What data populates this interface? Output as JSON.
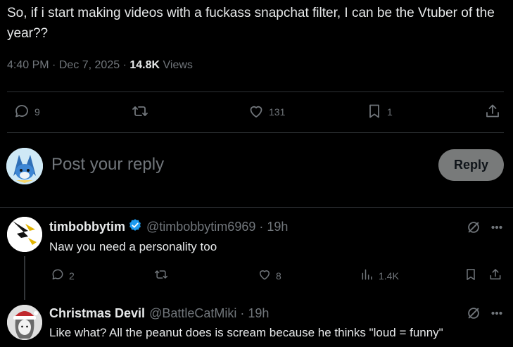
{
  "post": {
    "text": "So, if i start making videos with a fuckass snapchat filter, I can be the Vtuber of the year??",
    "time": "4:40 PM",
    "sep1": "·",
    "date": "Dec 7, 2025",
    "sep2": "·",
    "views_count": "14.8K",
    "views_label": "Views",
    "replies": "9",
    "likes": "131",
    "bookmarks": "1"
  },
  "compose": {
    "placeholder": "Post your reply",
    "button_label": "Reply"
  },
  "replies": [
    {
      "name": "timbobbytim",
      "handle": "@timbobbytim6969 · 19h",
      "text": "Naw you need a personality too",
      "replies": "2",
      "likes": "8",
      "views": "1.4K"
    },
    {
      "name": "Christmas Devil",
      "handle": "@BattleCatMiki · 19h",
      "text": "Like what? All the peanut does is scream because he thinks \"loud = funny\""
    }
  ],
  "colors": {
    "background": "#000000",
    "text": "#e7e9ea",
    "muted": "#71767b",
    "divider": "#2f3336",
    "verified": "#1d9bf0"
  }
}
